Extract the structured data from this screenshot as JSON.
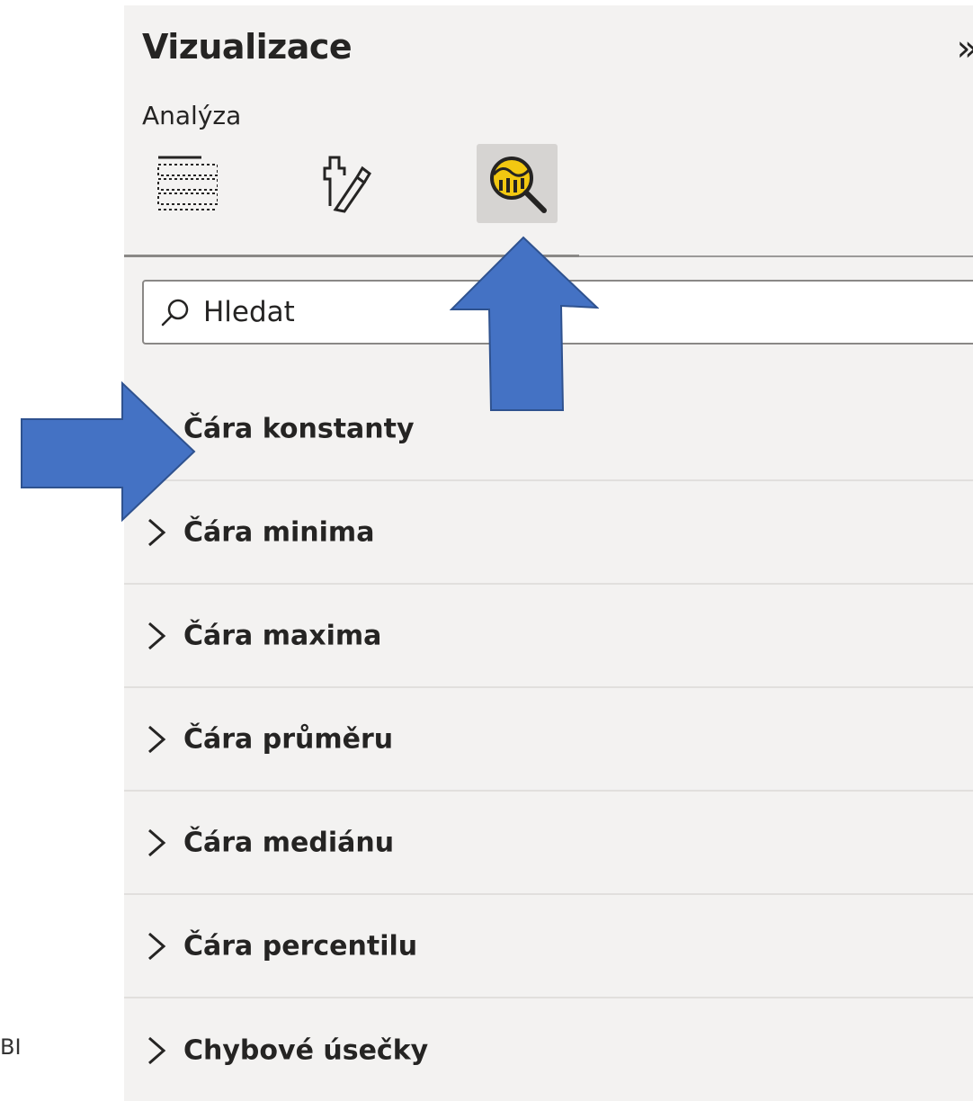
{
  "corner_text": "BI",
  "pane": {
    "title": "Vizualizace",
    "collapse_glyph": "»",
    "subtitle": "Analýza",
    "tabs": [
      {
        "icon": "fields-icon",
        "selected": false
      },
      {
        "icon": "format-paintbrush-icon",
        "selected": false
      },
      {
        "icon": "analytics-magnifier-icon",
        "selected": true
      }
    ]
  },
  "search": {
    "placeholder": "Hledat",
    "value": ""
  },
  "sections": [
    {
      "label": "Čára konstanty"
    },
    {
      "label": "Čára minima"
    },
    {
      "label": "Čára maxima"
    },
    {
      "label": "Čára průměru"
    },
    {
      "label": "Čára mediánu"
    },
    {
      "label": "Čára percentilu"
    },
    {
      "label": "Chybové úsečky"
    }
  ],
  "colors": {
    "pane_bg": "#f3f2f1",
    "callout_arrow": "#4472c4",
    "analytics_icon_fill": "#f2c811"
  }
}
